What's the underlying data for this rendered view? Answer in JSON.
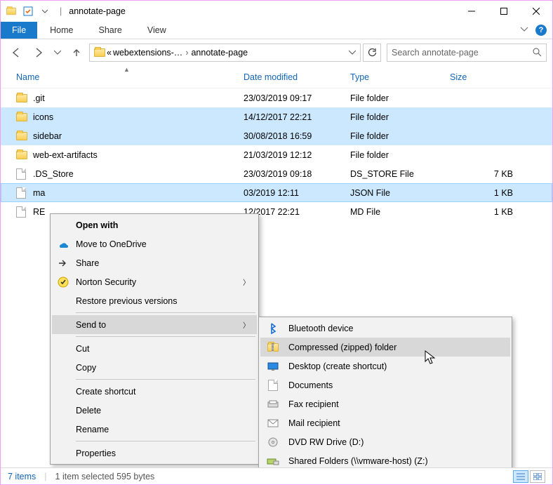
{
  "window": {
    "title": "annotate-page"
  },
  "ribbon": {
    "file": "File",
    "tabs": [
      "Home",
      "Share",
      "View"
    ]
  },
  "breadcrumb": {
    "prefix": "«",
    "parts": [
      "webextensions-…",
      "annotate-page"
    ]
  },
  "search": {
    "placeholder": "Search annotate-page"
  },
  "columns": {
    "name": "Name",
    "date": "Date modified",
    "type": "Type",
    "size": "Size"
  },
  "files": [
    {
      "name": ".git",
      "date": "23/03/2019 09:17",
      "type": "File folder",
      "size": "",
      "kind": "folder",
      "sel": false
    },
    {
      "name": "icons",
      "date": "14/12/2017 22:21",
      "type": "File folder",
      "size": "",
      "kind": "folder",
      "sel": true
    },
    {
      "name": "sidebar",
      "date": "30/08/2018 16:59",
      "type": "File folder",
      "size": "",
      "kind": "folder",
      "sel": true
    },
    {
      "name": "web-ext-artifacts",
      "date": "21/03/2019 12:12",
      "type": "File folder",
      "size": "",
      "kind": "folder",
      "sel": false
    },
    {
      "name": ".DS_Store",
      "date": "23/03/2019 09:18",
      "type": "DS_STORE File",
      "size": "7 KB",
      "kind": "file",
      "sel": false
    },
    {
      "name": "ma",
      "date": "03/2019 12:11",
      "type": "JSON File",
      "size": "1 KB",
      "kind": "file",
      "sel": true,
      "focus": true
    },
    {
      "name": "RE",
      "date": "12/2017 22:21",
      "type": "MD File",
      "size": "1 KB",
      "kind": "file",
      "sel": false
    }
  ],
  "statusbar": {
    "items": "7 items",
    "selected": "1 item selected   595 bytes"
  },
  "context_menu_1": [
    {
      "label": "Open with",
      "bold": true
    },
    {
      "label": "Move to OneDrive",
      "icon": "onedrive"
    },
    {
      "label": "Share",
      "icon": "share"
    },
    {
      "label": "Norton Security",
      "icon": "norton",
      "submenu": true
    },
    {
      "label": "Restore previous versions"
    },
    {
      "sep": true
    },
    {
      "label": "Send to",
      "submenu": true,
      "hover": true
    },
    {
      "sep": true
    },
    {
      "label": "Cut"
    },
    {
      "label": "Copy"
    },
    {
      "sep": true
    },
    {
      "label": "Create shortcut"
    },
    {
      "label": "Delete"
    },
    {
      "label": "Rename"
    },
    {
      "sep": true
    },
    {
      "label": "Properties"
    }
  ],
  "context_menu_2": [
    {
      "label": "Bluetooth device",
      "icon": "bluetooth"
    },
    {
      "label": "Compressed (zipped) folder",
      "icon": "zip",
      "hover": true
    },
    {
      "label": "Desktop (create shortcut)",
      "icon": "desktop"
    },
    {
      "label": "Documents",
      "icon": "docs"
    },
    {
      "label": "Fax recipient",
      "icon": "fax"
    },
    {
      "label": "Mail recipient",
      "icon": "mail"
    },
    {
      "label": "DVD RW Drive (D:)",
      "icon": "dvd"
    },
    {
      "label": "Shared Folders (\\\\vmware-host) (Z:)",
      "icon": "netdrive"
    }
  ]
}
